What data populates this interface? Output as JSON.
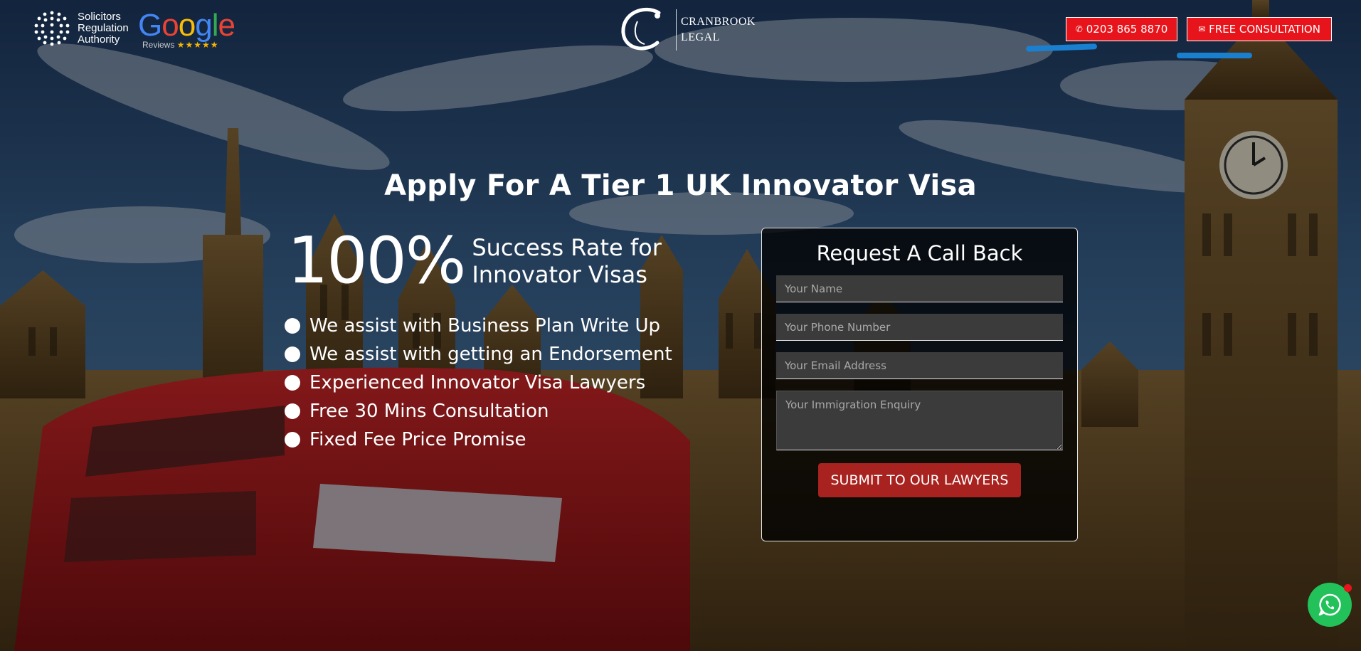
{
  "header": {
    "sra_text": [
      "Solicitors",
      "Regulation",
      "Authority"
    ],
    "google_word": [
      "G",
      "o",
      "o",
      "g",
      "l",
      "e"
    ],
    "google_colors": [
      "#4285F4",
      "#EA4335",
      "#FBBC05",
      "#4285F4",
      "#34A853",
      "#EA4335"
    ],
    "google_reviews_label": "Reviews",
    "google_stars": "★★★★★",
    "logo_letter": "C",
    "logo_line1": "CRANBROOK",
    "logo_line2": "LEGAL",
    "phone_icon": "phone-icon",
    "phone_label": "0203 865 8870",
    "consult_icon": "chat-icon",
    "consult_label": "FREE CONSULTATION",
    "accent_color": "#e8141b",
    "scribble_color": "#1b7fd0"
  },
  "main": {
    "headline": "Apply For A Tier 1 UK Innovator Visa",
    "rate_big": "100%",
    "rate_line1": "Success Rate for",
    "rate_line2": "Innovator Visas",
    "bullets": [
      "We assist with Business Plan Write Up",
      "We assist with getting an Endorsement",
      "Experienced Innovator Visa Lawyers",
      "Free 30 Mins Consultation",
      "Fixed Fee Price Promise"
    ]
  },
  "form": {
    "title": "Request A Call Back",
    "name_placeholder": "Your Name",
    "phone_placeholder": "Your Phone Number",
    "email_placeholder": "Your Email Address",
    "enquiry_placeholder": "Your Immigration Enquiry",
    "submit_label": "SUBMIT TO OUR LAWYERS",
    "submit_color": "#a8231f"
  },
  "whatsapp": {
    "icon": "whatsapp-icon",
    "color": "#23c15a"
  }
}
